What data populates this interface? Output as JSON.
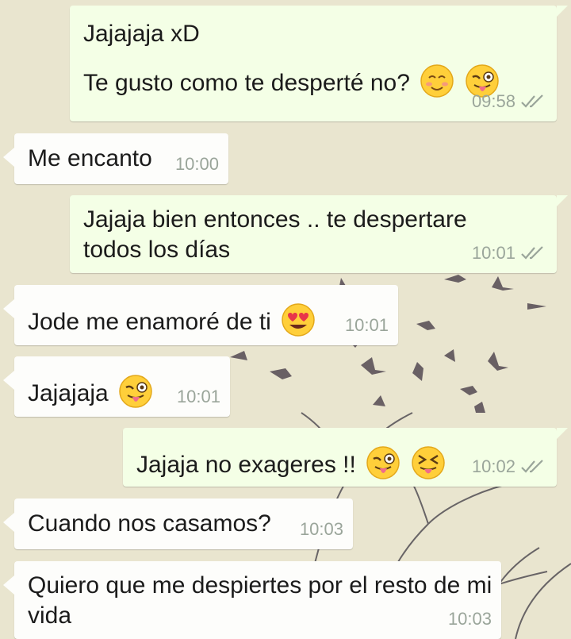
{
  "colors": {
    "background": "#e9e5cf",
    "outgoing_bubble": "#f4ffe6",
    "incoming_bubble": "#fdfdfb",
    "timestamp": "#9aa59a",
    "text": "#1b1b1b"
  },
  "messages": [
    {
      "direction": "outgoing",
      "lines": [
        "Jajajaja xD",
        "Te gusto como te desperté no?"
      ],
      "emojis": [
        "smiling-blush-emoji",
        "winking-tongue-emoji"
      ],
      "time": "09:58",
      "status": "read-double-check"
    },
    {
      "direction": "incoming",
      "text": "Me encanto",
      "emojis": [],
      "time": "10:00"
    },
    {
      "direction": "outgoing",
      "text": "Jajaja bien entonces .. te despertare todos los días",
      "emojis": [],
      "time": "10:01",
      "status": "read-double-check"
    },
    {
      "direction": "incoming",
      "text": "Jode me enamoré de ti",
      "emojis": [
        "heart-eyes-emoji"
      ],
      "time": "10:01"
    },
    {
      "direction": "incoming",
      "text": "Jajajaja",
      "emojis": [
        "winking-tongue-emoji"
      ],
      "time": "10:01"
    },
    {
      "direction": "outgoing",
      "text": "Jajaja no exageres !!",
      "emojis": [
        "winking-tongue-emoji",
        "squinting-tongue-emoji"
      ],
      "time": "10:02",
      "status": "read-double-check"
    },
    {
      "direction": "incoming",
      "text": "Cuando nos casamos?",
      "emojis": [],
      "time": "10:03"
    },
    {
      "direction": "incoming",
      "text": "Quiero que me despiertes por el resto de mi vida",
      "emojis": [],
      "time": "10:03"
    }
  ]
}
